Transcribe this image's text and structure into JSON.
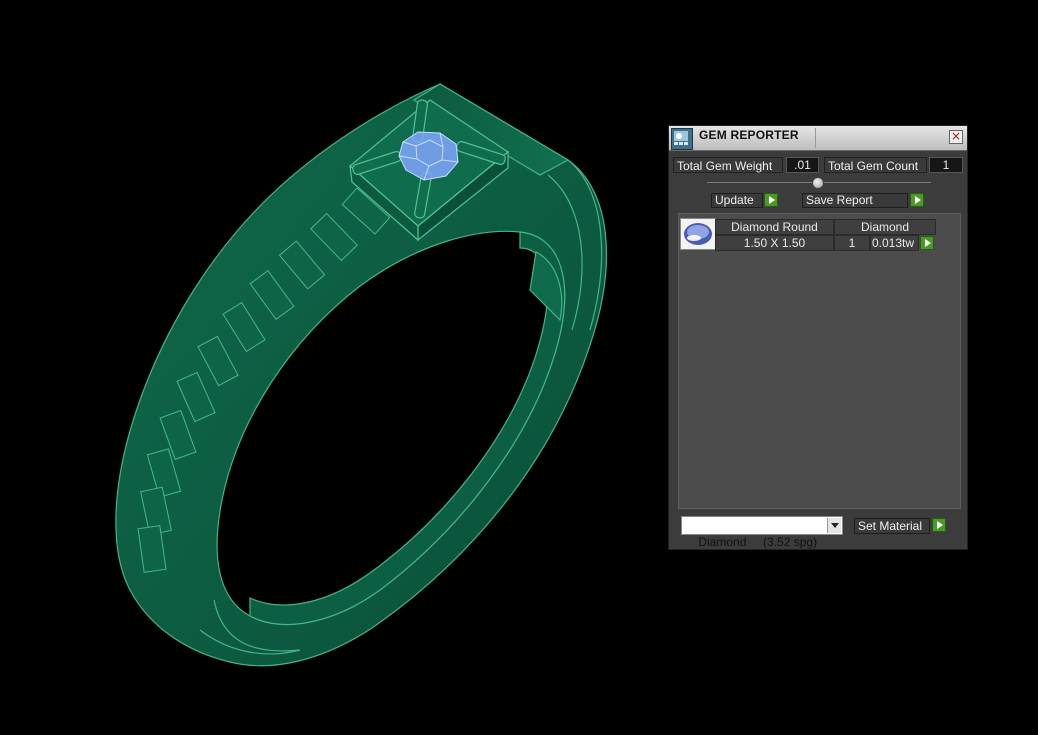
{
  "colors": {
    "ring_fill": "#0b5e43",
    "ring_edge": "#3fb07f",
    "gem_blue": "#8db4ff",
    "panel_bg": "#3c3c3c",
    "accent_green": "#4a9a2a"
  },
  "panel": {
    "title": "GEM REPORTER",
    "icon": "gem-reporter-icon",
    "close_icon": "close-icon",
    "total_weight_label": "Total Gem Weight",
    "total_weight_value": ".01",
    "total_count_label": "Total Gem Count",
    "total_count_value": "1",
    "update_label": "Update",
    "save_report_label": "Save Report",
    "gems": [
      {
        "name": "Diamond Round",
        "size": "1.50 X 1.50",
        "material": "Diamond",
        "count": "1",
        "weight": "0.013tw"
      }
    ],
    "material_select": "Diamond     (3.52 spg)",
    "set_material_label": "Set Material"
  }
}
